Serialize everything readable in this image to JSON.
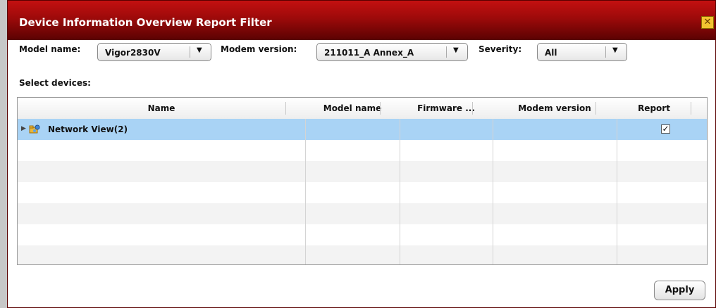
{
  "dialog": {
    "title": "Device Information Overview Report Filter",
    "close_label": "✕"
  },
  "filters": {
    "model_label": "Model name:",
    "model_value": "Vigor2830V",
    "modem_label": "Modem version:",
    "modem_value": "211011_A Annex_A",
    "severity_label": "Severity:",
    "severity_value": "All"
  },
  "select_devices_label": "Select devices:",
  "table": {
    "columns": [
      "Name",
      "Model name",
      "Firmware ...",
      "Modem version",
      "Report"
    ],
    "rows": [
      {
        "name": "Network View(2)",
        "model": "",
        "firmware": "",
        "modem": "",
        "report_checked": true
      }
    ]
  },
  "apply_label": "Apply",
  "colors": {
    "title_gradient_top": "#c41010",
    "title_gradient_bottom": "#5a0202",
    "selected_row": "#a9d3f5"
  },
  "icons": {
    "tree_expand": "triangle-right-icon",
    "network_node": "network-folder-icon",
    "combo_arrow": "chevron-down-icon"
  }
}
